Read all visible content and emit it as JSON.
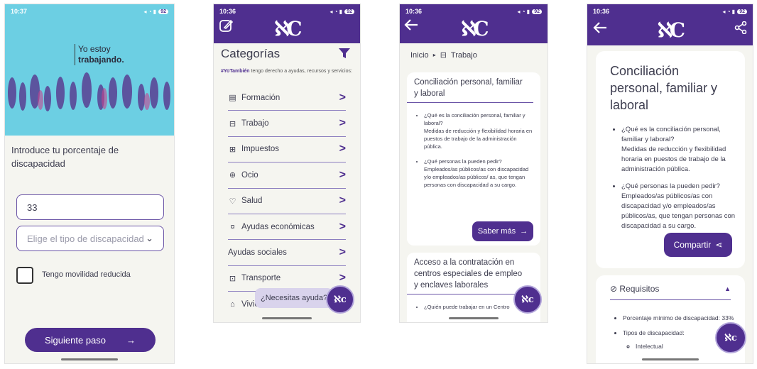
{
  "screen1": {
    "status_time": "10:37",
    "battery": "92",
    "hero_line1": "Yo estoy",
    "hero_line2": "trabajando.",
    "label": "Introduce tu porcentaje de discapacidad",
    "percentage_value": "33",
    "type_placeholder": "Elige el tipo de discapacidad",
    "mobility_label": "Tengo movilidad reducida",
    "next_button": "Siguiente paso",
    "next_arrow": "→"
  },
  "screen2": {
    "status_time": "10:36",
    "battery": "92",
    "logo": "ℵC",
    "title": "Categorías",
    "subtitle_tag": "#YoTambién",
    "subtitle_rest": " tengo derecho a ayudas, recursos y servicios:",
    "categories": [
      {
        "icon": "book-icon",
        "glyph": "▤",
        "label": "Formación"
      },
      {
        "icon": "briefcase-icon",
        "glyph": "⊟",
        "label": "Trabajo"
      },
      {
        "icon": "money-icon",
        "glyph": "⊞",
        "label": "Impuestos"
      },
      {
        "icon": "ball-icon",
        "glyph": "⊛",
        "label": "Ocio"
      },
      {
        "icon": "heart-icon",
        "glyph": "♡",
        "label": "Salud"
      },
      {
        "icon": "hand-coin-icon",
        "glyph": "¤",
        "label": "Ayudas económicas"
      },
      {
        "icon": "",
        "glyph": "",
        "label": "Ayudas sociales"
      },
      {
        "icon": "bus-icon",
        "glyph": "⊡",
        "label": "Transporte"
      },
      {
        "icon": "house-icon",
        "glyph": "⌂",
        "label": "Vivienda"
      }
    ],
    "help_label": "¿Necesitas ayuda?"
  },
  "screen3": {
    "status_time": "10:36",
    "battery": "92",
    "crumb_home": "Inicio",
    "crumb_current": "Trabajo",
    "card1_title": "Conciliación personal, familiar y laboral",
    "card1_q1": "¿Qué es la conciliación personal, familiar y laboral?",
    "card1_a1": "Medidas de reducción y flexibilidad horaria en puestos de trabajo de la administración pública.",
    "card1_q2": "¿Qué personas la pueden pedir?",
    "card1_a2": "Empleados/as públicos/as con discapacidad y/o empleados/as públicos/ as, que tengan personas con discapacidad a su cargo.",
    "more_button": "Saber más",
    "card2_title": "Acceso a la contratación en centros especiales de empleo y enclaves laborales",
    "card2_q1": "¿Quién puede trabajar en un Centro"
  },
  "screen4": {
    "status_time": "10:36",
    "battery": "92",
    "title": "Conciliación personal, familiar y laboral",
    "q1": "¿Qué es la conciliación personal, familiar y laboral?",
    "a1": "Medidas de reducción y flexibilidad horaria en puestos de trabajo de la administración pública.",
    "q2": "¿Qué personas la pueden pedir?",
    "a2": "Empleados/as públicos/as con discapacidad y/o empleados/as públicos/as, que tengan personas con discapacidad a su cargo.",
    "share_button": "Compartir",
    "requirements_title": "Requisitos",
    "req1": "Porcentaje mínimo de discapacidad: 33%",
    "req2": "Tipos de discapacidad:",
    "req2_sub1": "Intelectual"
  },
  "colors": {
    "primary": "#4f2f8f",
    "hero_bg": "#6ccfe3",
    "screen_bg": "#f5f5f0"
  }
}
